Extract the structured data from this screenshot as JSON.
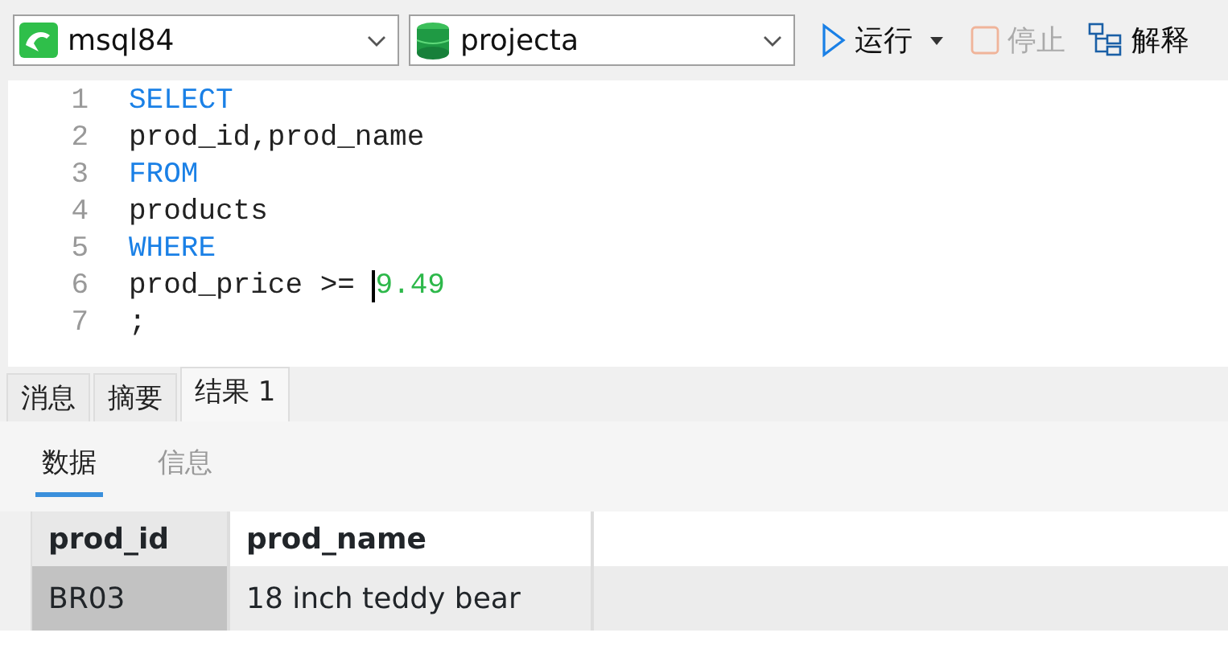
{
  "toolbar": {
    "connection": {
      "label": "msql84"
    },
    "database": {
      "label": "projecta"
    },
    "buttons": [
      {
        "kind": "run",
        "label": "运行",
        "disabled": false
      },
      {
        "kind": "stop",
        "label": "停止",
        "disabled": true
      },
      {
        "kind": "explain",
        "label": "解释",
        "disabled": false
      }
    ]
  },
  "editor": {
    "lines": [
      {
        "number": "1",
        "tokens": [
          {
            "kind": "keyword",
            "text": "SELECT"
          }
        ]
      },
      {
        "number": "2",
        "tokens": [
          {
            "kind": "plain",
            "text": "prod_id,prod_name"
          }
        ]
      },
      {
        "number": "3",
        "tokens": [
          {
            "kind": "keyword",
            "text": "FROM"
          }
        ]
      },
      {
        "number": "4",
        "tokens": [
          {
            "kind": "plain",
            "text": "products"
          }
        ]
      },
      {
        "number": "5",
        "tokens": [
          {
            "kind": "keyword",
            "text": "WHERE"
          }
        ]
      },
      {
        "number": "6",
        "tokens": [
          {
            "kind": "plain",
            "text": "prod_price >= "
          },
          {
            "kind": "number",
            "text": "9.49",
            "caret": true
          }
        ]
      },
      {
        "number": "7",
        "tokens": [
          {
            "kind": "plain",
            "text": ";"
          }
        ]
      }
    ]
  },
  "result_tabs": [
    {
      "label": "消息",
      "selected": false
    },
    {
      "label": "摘要",
      "selected": false
    },
    {
      "label": "结果 1",
      "selected": true
    }
  ],
  "view_tabs": [
    {
      "label": "数据",
      "selected": true
    },
    {
      "label": "信息",
      "selected": false
    }
  ],
  "table": {
    "columns": [
      "prod_id",
      "prod_name"
    ],
    "rows": [
      {
        "selected": true,
        "cells": [
          {
            "text": "BR03",
            "selected": true
          },
          {
            "text": "18 inch teddy bear",
            "selected": false
          }
        ]
      }
    ]
  }
}
